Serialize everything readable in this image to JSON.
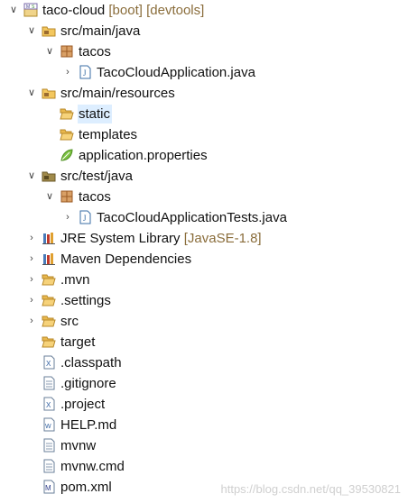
{
  "tree": {
    "project": {
      "name": "taco-cloud",
      "decoration": "[boot] [devtools]"
    },
    "src_main_java": "src/main/java",
    "pkg_main": "tacos",
    "main_app": "TacoCloudApplication.java",
    "src_main_resources": "src/main/resources",
    "static": "static",
    "templates": "templates",
    "app_props": "application.properties",
    "src_test_java": "src/test/java",
    "pkg_test": "tacos",
    "test_app": "TacoCloudApplicationTests.java",
    "jre": {
      "name": "JRE System Library",
      "decoration": "[JavaSE-1.8]"
    },
    "maven_deps": "Maven Dependencies",
    "mvn": ".mvn",
    "settings": ".settings",
    "src": "src",
    "target": "target",
    "classpath": ".classpath",
    "gitignore": ".gitignore",
    "project_file": ".project",
    "help": "HELP.md",
    "mvnw": "mvnw",
    "mvnw_cmd": "mvnw.cmd",
    "pom": "pom.xml"
  },
  "watermark": "https://blog.csdn.net/qq_39530821",
  "colors": {
    "folder": "#e8b84a",
    "package": "#b5652b",
    "decoration": "#8a6d3b",
    "selection": "#ddeeff"
  },
  "icons": {
    "expanded": "chevron-down-icon",
    "collapsed": "chevron-right-icon"
  }
}
